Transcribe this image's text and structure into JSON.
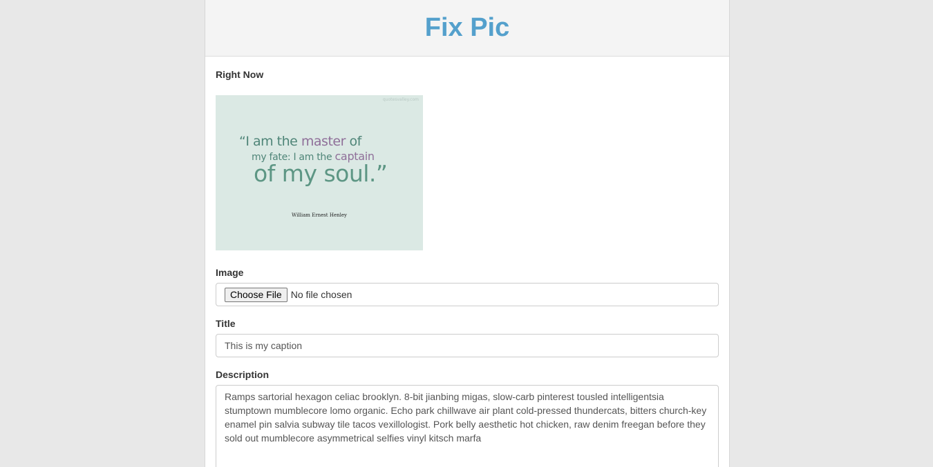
{
  "header": {
    "title": "Fix Pic"
  },
  "current_image": {
    "label": "Right Now",
    "picture": {
      "quote_line1_a": "“I am the ",
      "quote_line1_b": "master",
      "quote_line1_c": " of",
      "quote_line2_a": "my fate: I am the ",
      "quote_line2_b": "captain",
      "quote_line3": "of my soul.”",
      "author": "William Ernest Henley",
      "watermark": "quotesvalley.com"
    }
  },
  "image_field": {
    "label": "Image",
    "button_label": "Choose File",
    "status": "No file chosen"
  },
  "title_field": {
    "label": "Title",
    "value": "This is my caption"
  },
  "description_field": {
    "label": "Description",
    "value": "Ramps sartorial hexagon celiac brooklyn. 8-bit jianbing migas, slow-carb pinterest tousled intelligentsia stumptown mumblecore lomo organic. Echo park chillwave air plant cold-pressed thundercats, bitters church-key enamel pin salvia subway tile tacos vexillologist. Pork belly aesthetic hot chicken, raw denim freegan before they sold out mumblecore asymmetrical selfies vinyl kitsch marfa"
  },
  "colors": {
    "title_accent": "#54a0cc",
    "page_background": "#e8e8e8",
    "header_background": "#f4f4f4",
    "picture_background": "#dbe9e4"
  }
}
